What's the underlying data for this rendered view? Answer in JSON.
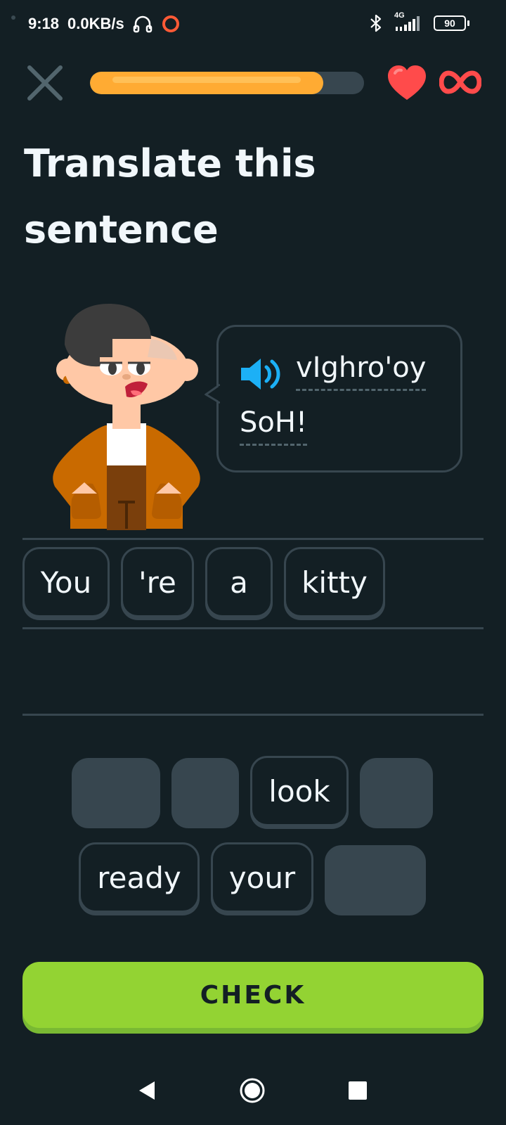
{
  "status_bar": {
    "time": "9:18",
    "net_speed": "0.0KB/s",
    "network_type": "4G",
    "battery": "90",
    "icons": [
      "headset-icon",
      "record-icon",
      "bluetooth-icon",
      "signal-icon",
      "battery-icon"
    ]
  },
  "header": {
    "progress": 0.85,
    "icons": [
      "close-icon",
      "heart-icon",
      "infinity-icon"
    ],
    "colors": {
      "progress_fill": "#ffab33",
      "heart": "#ff4b4b"
    }
  },
  "title": "Translate this sentence",
  "prompt": {
    "words": [
      "vIghro'oy",
      "SoH!"
    ],
    "icon": "speaker-icon"
  },
  "answer_chips": [
    "You",
    "'re",
    "a",
    "kitty"
  ],
  "word_bank": {
    "row1": [
      "",
      "",
      "look",
      ""
    ],
    "row2": [
      "ready",
      "your",
      ""
    ]
  },
  "check_button": "CHECK",
  "colors": {
    "background": "#131f24",
    "border": "#37464f",
    "accent_green": "#93d333",
    "speaker": "#1cb0f6"
  },
  "nav": {
    "icons": [
      "back-icon",
      "home-icon",
      "recents-icon"
    ]
  }
}
